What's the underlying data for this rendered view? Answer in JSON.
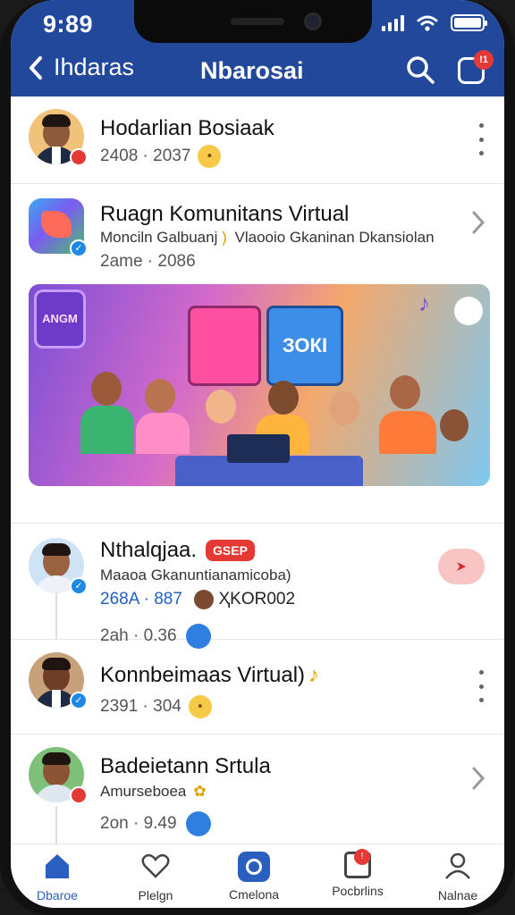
{
  "status": {
    "time": "9:89"
  },
  "header": {
    "back_label": "Ihdaras",
    "title": "Nbarosai",
    "notification_badge": "!1"
  },
  "feed": {
    "rows": [
      {
        "title": "Hodarlian Bosiaak",
        "meta": "2408 · 2037"
      },
      {
        "title": "Ruagn Komunitans Virtual",
        "subtitle": "Monciln Galbuanj",
        "subtitle_right": "Vlaooio Gkaninan Dkansiolan",
        "meta": "2ame · 2086"
      },
      {
        "title": "Nthalqjaa.",
        "live_label": "GSEP",
        "subtitle": "Maaoa Gkanuntianamicoba)",
        "meta": "268A · 887",
        "meta_extra": "ҲKOR002",
        "meta2": "2ah · 0.36"
      },
      {
        "title": "Konnbeimaas Virtual)",
        "meta": "2391 · 304"
      },
      {
        "title": "Badeietann Srtula",
        "subtitle": "Amurseboea",
        "meta": "2on · 9.49"
      }
    ],
    "banner": {
      "sign_text": "ANGM",
      "screen_text": "ЗОКІ"
    }
  },
  "bottom_nav": {
    "tabs": [
      {
        "label": "Dbaroe",
        "icon": "home-icon"
      },
      {
        "label": "Plelgn",
        "icon": "heart-chat-icon"
      },
      {
        "label": "Cmelona",
        "icon": "camera-icon"
      },
      {
        "label": "Pocbrlins",
        "icon": "calendar-icon",
        "badge": "!"
      },
      {
        "label": "Nalnae",
        "icon": "profile-icon"
      }
    ]
  },
  "colors": {
    "header": "#21489b",
    "accent": "#2b5fbf",
    "badge": "#e53935"
  }
}
